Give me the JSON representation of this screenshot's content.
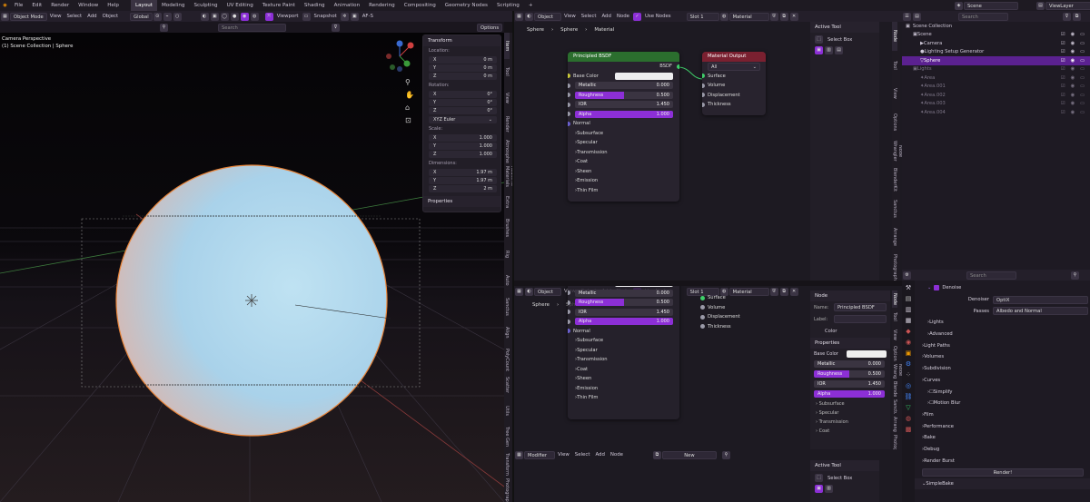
{
  "menu": [
    "File",
    "Edit",
    "Render",
    "Window",
    "Help"
  ],
  "workspaces": [
    "Layout",
    "Modeling",
    "Sculpting",
    "UV Editing",
    "Texture Paint",
    "Shading",
    "Animation",
    "Rendering",
    "Compositing",
    "Geometry Nodes",
    "Scripting",
    "+"
  ],
  "scene": "Scene",
  "view_layer": "ViewLayer",
  "viewport": {
    "mode": "Object Mode",
    "menus": [
      "View",
      "Select",
      "Add",
      "Object"
    ],
    "transform": "Global",
    "search_placeholder": "Search",
    "options": "Options",
    "viewport_btn": "Viewport",
    "snapshot_btn": "Snapshot",
    "af": "AF-S",
    "info_title": "Camera Perspective",
    "info_sub": "(1) Scene Collection | Sphere"
  },
  "transform": {
    "title": "Transform",
    "location_label": "Location:",
    "rotation_label": "Rotation:",
    "scale_label": "Scale:",
    "dims_label": "Dimensions:",
    "location": [
      [
        "X",
        "0 m"
      ],
      [
        "Y",
        "0 m"
      ],
      [
        "Z",
        "0 m"
      ]
    ],
    "rotation": [
      [
        "X",
        "0°"
      ],
      [
        "Y",
        "0°"
      ],
      [
        "Z",
        "0°"
      ]
    ],
    "euler": "XYZ Euler",
    "scale": [
      [
        "X",
        "1.000"
      ],
      [
        "Y",
        "1.000"
      ],
      [
        "Z",
        "1.000"
      ]
    ],
    "dims": [
      [
        "X",
        "1.97 m"
      ],
      [
        "Y",
        "1.97 m"
      ],
      [
        "Z",
        "2 m"
      ]
    ],
    "properties": "Properties"
  },
  "vp_tabs": [
    "Item",
    "Tool",
    "View",
    "Render",
    "Atmosphere",
    "Realtime Materials",
    "Extra",
    "Brushes",
    "Rig",
    "Auto",
    "Sanctus",
    "Align",
    "PolyCount",
    "Scatter",
    "Utils",
    "Tree Gen",
    "Transform",
    "Photographer"
  ],
  "node_editor": {
    "type": "Object",
    "menus": [
      "View",
      "Select",
      "Add",
      "Node"
    ],
    "use_nodes": "Use Nodes",
    "slot": "Slot 1",
    "material": "Material",
    "breadcrumb": [
      "Sphere",
      "Sphere",
      "Material"
    ]
  },
  "bsdf": {
    "title": "Principled BSDF",
    "out": "BSDF",
    "base_color": "Base Color",
    "metallic": [
      "Metallic",
      "0.000"
    ],
    "roughness": [
      "Roughness",
      "0.500"
    ],
    "ior": [
      "IOR",
      "1.450"
    ],
    "alpha": [
      "Alpha",
      "1.000"
    ],
    "normal": "Normal",
    "subs": [
      "Subsurface",
      "Specular",
      "Transmission",
      "Coat",
      "Sheen",
      "Emission",
      "Thin Film"
    ]
  },
  "matout": {
    "title": "Material Output",
    "target": "All",
    "inputs": [
      "Surface",
      "Volume",
      "Displacement",
      "Thickness"
    ]
  },
  "active_tool": {
    "title": "Active Tool",
    "tool": "Select Box"
  },
  "node_tabs": [
    "Node",
    "Tool",
    "View",
    "Options",
    "Node Wrangler",
    "BlenderKit",
    "Sanctus",
    "Arrange",
    "Photographer"
  ],
  "node_panel": {
    "title": "Node",
    "name_label": "Name:",
    "name": "Principled BSDF",
    "label_label": "Label:",
    "color": "Color",
    "properties": "Properties",
    "base_color": "Base Color",
    "metallic": [
      "Metallic",
      "0.000"
    ],
    "roughness": [
      "Roughness",
      "0.500"
    ],
    "ior": [
      "IOR",
      "1.450"
    ],
    "alpha": [
      "Alpha",
      "1.000"
    ],
    "subs": [
      "Subsurface",
      "Specular",
      "Transmission",
      "Coat"
    ]
  },
  "bottom": {
    "editor": "Modifier",
    "menus": [
      "View",
      "Select",
      "Add",
      "Node"
    ],
    "new_btn": "New"
  },
  "outliner": {
    "root": "Scene Collection",
    "items": [
      {
        "name": "Scene",
        "d": 1
      },
      {
        "name": "Camera",
        "d": 2
      },
      {
        "name": "Lighting Setup Generator",
        "d": 2
      },
      {
        "name": "Sphere",
        "d": 2,
        "sel": true
      },
      {
        "name": "Lights",
        "d": 1
      },
      {
        "name": "Area",
        "d": 2
      },
      {
        "name": "Area.001",
        "d": 2
      },
      {
        "name": "Area.002",
        "d": 2
      },
      {
        "name": "Area.003",
        "d": 2
      },
      {
        "name": "Area.004",
        "d": 2
      }
    ]
  },
  "properties": {
    "search_placeholder": "Search",
    "denoise": "Denoise",
    "denoiser_label": "Denoiser",
    "denoiser": "OptiX",
    "passes_label": "Passes",
    "passes": "Albedo and Normal",
    "sections": [
      "Lights",
      "Advanced",
      "Light Paths",
      "Volumes",
      "Subdivision",
      "Curves",
      "Simplify",
      "Motion Blur",
      "Film",
      "Performance",
      "Bake",
      "Debug",
      "Render Burst"
    ],
    "render_btn": "Render!",
    "simplebake": "SimpleBake"
  },
  "colors": {
    "accent": "#8c2fd6",
    "header": "#241f2a",
    "panel": "#221e27"
  }
}
